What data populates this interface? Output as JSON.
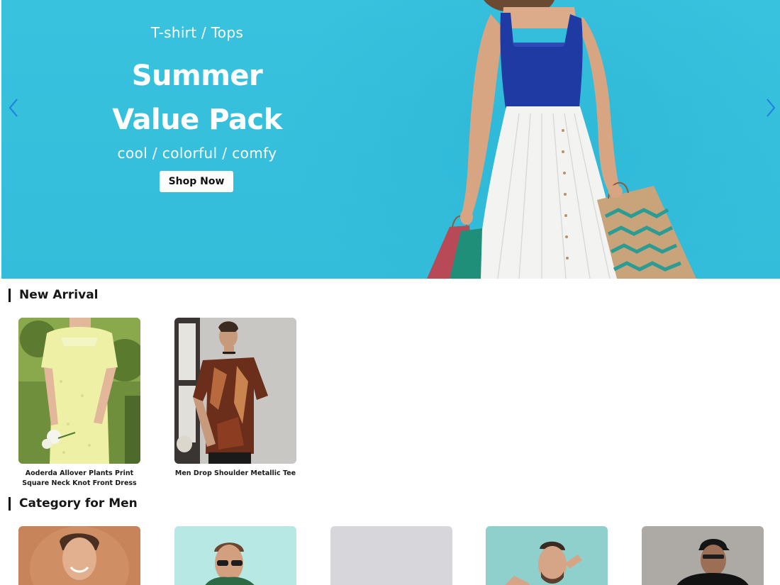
{
  "hero": {
    "eyebrow": "T-shirt / Tops",
    "title_line1": "Summer",
    "title_line2": "Value Pack",
    "subtitle": "cool / colorful / comfy",
    "cta_label": "Shop Now",
    "prev_icon": "chevron-left-icon",
    "next_icon": "chevron-right-icon",
    "colors": {
      "background": "#35bfdc",
      "arrow": "#1e7fe0"
    }
  },
  "new_arrival": {
    "title": "New Arrival",
    "products": [
      {
        "name": "Aoderda Allover Plants Print Square Neck Knot Front Dress"
      },
      {
        "name": "Men Drop Shoulder Metallic Tee"
      }
    ]
  },
  "category_men": {
    "title": "Category for Men",
    "items": [
      {
        "image": "man-smiling-tan-backdrop"
      },
      {
        "image": "man-sunglasses-mint-backdrop"
      },
      {
        "image": "placeholder-grey"
      },
      {
        "image": "man-teal-backdrop"
      },
      {
        "image": "man-cap-concrete-backdrop"
      }
    ]
  }
}
